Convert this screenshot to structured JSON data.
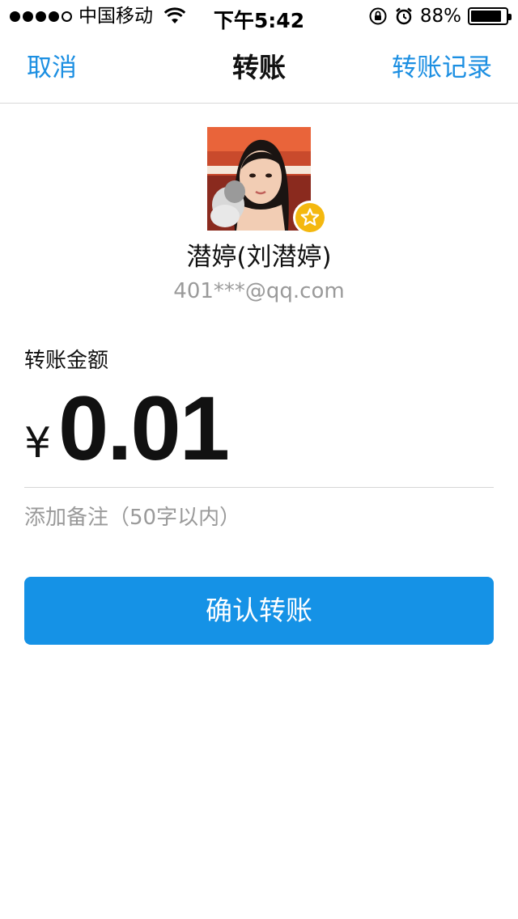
{
  "status_bar": {
    "carrier": "中国移动",
    "time": "下午5:42",
    "battery_percent": "88%",
    "battery_level": 0.88
  },
  "nav": {
    "cancel_label": "取消",
    "title": "转账",
    "records_label": "转账记录"
  },
  "recipient": {
    "name": "潜婷(刘潜婷)",
    "account": "401***@qq.com"
  },
  "amount": {
    "label": "转账金额",
    "currency_symbol": "¥",
    "value": "0.01"
  },
  "note": {
    "placeholder": "添加备注（50字以内）"
  },
  "confirm_button": {
    "label": "确认转账"
  },
  "colors": {
    "accent": "#1c8fe2",
    "button": "#1592e6",
    "badge": "#f4b80f"
  }
}
